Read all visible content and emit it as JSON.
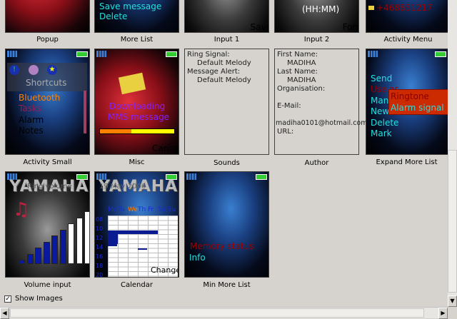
{
  "thumbnails": [
    {
      "label": "Popup"
    },
    {
      "label": "More List",
      "items": [
        "Save message",
        "Delete"
      ]
    },
    {
      "label": "Input 1",
      "softkey": "Save"
    },
    {
      "label": "Input 2",
      "time_format": "(HH:MM)",
      "softkey": "Format"
    },
    {
      "label": "Activity Menu",
      "number": "+468851217"
    },
    {
      "label": "Activity Small",
      "title": "Shortcuts",
      "items": [
        "Bluetooth",
        "Tasks",
        "Alarm",
        "Notes"
      ]
    },
    {
      "label": "Misc",
      "message": [
        "Downloading",
        "MMS message"
      ],
      "progress": 0.42,
      "softkey": "Cancel"
    },
    {
      "label": "Sounds",
      "lines": [
        "Ring Signal:",
        "Default Melody",
        "Message Alert:",
        "Default Melody"
      ]
    },
    {
      "label": "Author",
      "lines": [
        "First Name:",
        "MADIHA",
        "Last Name:",
        "MADIHA",
        "Organisation:",
        "E-Mail:",
        "madiha0101@hotmail.com",
        "URL:"
      ]
    },
    {
      "label": "Expand More List",
      "items": [
        "Send",
        "Use as",
        "Manage",
        "New",
        "Delete",
        "Mark"
      ],
      "submenu": [
        "Ringtone",
        "Alarm signal"
      ]
    },
    {
      "label": "Volume input",
      "brand": "YAMAHA",
      "title": "Ring volume",
      "level": 6
    },
    {
      "label": "Calendar",
      "brand": "YAMAHA",
      "date": "19 May 2006",
      "days": [
        "Mo",
        "Tu",
        "We",
        "Th",
        "Fr",
        "Sa",
        "Su"
      ],
      "hours": [
        "08",
        "10",
        "12",
        "14",
        "16",
        "18",
        "20"
      ],
      "softkey": "Change"
    },
    {
      "label": "Min More List",
      "items": [
        "Memory status",
        "Info"
      ]
    }
  ],
  "show_images": {
    "label": "Show Images",
    "checked": true
  }
}
